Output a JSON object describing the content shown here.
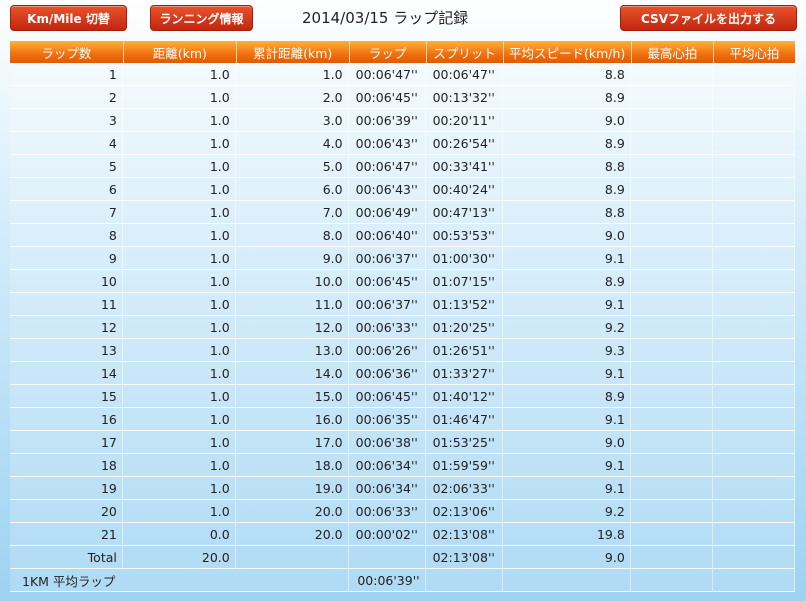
{
  "toolbar": {
    "km_mile_label": "Km/Mile 切替",
    "running_info_label": "ランニング情報",
    "csv_label": "CSVファイルを出力する"
  },
  "page_title": "2014/03/15 ラップ記録",
  "headers": [
    "ラップ数",
    "距離(km)",
    "累計距離(km)",
    "ラップ",
    "スプリット",
    "平均スピード(km/h)",
    "最高心拍",
    "平均心拍"
  ],
  "laps": [
    {
      "lap": "1",
      "dist": "1.0",
      "cum": "1.0",
      "lap_time": "00:06'47''",
      "split": "00:06'47''",
      "speed": "8.8",
      "max_hr": "",
      "avg_hr": ""
    },
    {
      "lap": "2",
      "dist": "1.0",
      "cum": "2.0",
      "lap_time": "00:06'45''",
      "split": "00:13'32''",
      "speed": "8.9",
      "max_hr": "",
      "avg_hr": ""
    },
    {
      "lap": "3",
      "dist": "1.0",
      "cum": "3.0",
      "lap_time": "00:06'39''",
      "split": "00:20'11''",
      "speed": "9.0",
      "max_hr": "",
      "avg_hr": ""
    },
    {
      "lap": "4",
      "dist": "1.0",
      "cum": "4.0",
      "lap_time": "00:06'43''",
      "split": "00:26'54''",
      "speed": "8.9",
      "max_hr": "",
      "avg_hr": ""
    },
    {
      "lap": "5",
      "dist": "1.0",
      "cum": "5.0",
      "lap_time": "00:06'47''",
      "split": "00:33'41''",
      "speed": "8.8",
      "max_hr": "",
      "avg_hr": ""
    },
    {
      "lap": "6",
      "dist": "1.0",
      "cum": "6.0",
      "lap_time": "00:06'43''",
      "split": "00:40'24''",
      "speed": "8.9",
      "max_hr": "",
      "avg_hr": ""
    },
    {
      "lap": "7",
      "dist": "1.0",
      "cum": "7.0",
      "lap_time": "00:06'49''",
      "split": "00:47'13''",
      "speed": "8.8",
      "max_hr": "",
      "avg_hr": ""
    },
    {
      "lap": "8",
      "dist": "1.0",
      "cum": "8.0",
      "lap_time": "00:06'40''",
      "split": "00:53'53''",
      "speed": "9.0",
      "max_hr": "",
      "avg_hr": ""
    },
    {
      "lap": "9",
      "dist": "1.0",
      "cum": "9.0",
      "lap_time": "00:06'37''",
      "split": "01:00'30''",
      "speed": "9.1",
      "max_hr": "",
      "avg_hr": ""
    },
    {
      "lap": "10",
      "dist": "1.0",
      "cum": "10.0",
      "lap_time": "00:06'45''",
      "split": "01:07'15''",
      "speed": "8.9",
      "max_hr": "",
      "avg_hr": ""
    },
    {
      "lap": "11",
      "dist": "1.0",
      "cum": "11.0",
      "lap_time": "00:06'37''",
      "split": "01:13'52''",
      "speed": "9.1",
      "max_hr": "",
      "avg_hr": ""
    },
    {
      "lap": "12",
      "dist": "1.0",
      "cum": "12.0",
      "lap_time": "00:06'33''",
      "split": "01:20'25''",
      "speed": "9.2",
      "max_hr": "",
      "avg_hr": ""
    },
    {
      "lap": "13",
      "dist": "1.0",
      "cum": "13.0",
      "lap_time": "00:06'26''",
      "split": "01:26'51''",
      "speed": "9.3",
      "max_hr": "",
      "avg_hr": ""
    },
    {
      "lap": "14",
      "dist": "1.0",
      "cum": "14.0",
      "lap_time": "00:06'36''",
      "split": "01:33'27''",
      "speed": "9.1",
      "max_hr": "",
      "avg_hr": ""
    },
    {
      "lap": "15",
      "dist": "1.0",
      "cum": "15.0",
      "lap_time": "00:06'45''",
      "split": "01:40'12''",
      "speed": "8.9",
      "max_hr": "",
      "avg_hr": ""
    },
    {
      "lap": "16",
      "dist": "1.0",
      "cum": "16.0",
      "lap_time": "00:06'35''",
      "split": "01:46'47''",
      "speed": "9.1",
      "max_hr": "",
      "avg_hr": ""
    },
    {
      "lap": "17",
      "dist": "1.0",
      "cum": "17.0",
      "lap_time": "00:06'38''",
      "split": "01:53'25''",
      "speed": "9.0",
      "max_hr": "",
      "avg_hr": ""
    },
    {
      "lap": "18",
      "dist": "1.0",
      "cum": "18.0",
      "lap_time": "00:06'34''",
      "split": "01:59'59''",
      "speed": "9.1",
      "max_hr": "",
      "avg_hr": ""
    },
    {
      "lap": "19",
      "dist": "1.0",
      "cum": "19.0",
      "lap_time": "00:06'34''",
      "split": "02:06'33''",
      "speed": "9.1",
      "max_hr": "",
      "avg_hr": ""
    },
    {
      "lap": "20",
      "dist": "1.0",
      "cum": "20.0",
      "lap_time": "00:06'33''",
      "split": "02:13'06''",
      "speed": "9.2",
      "max_hr": "",
      "avg_hr": ""
    },
    {
      "lap": "21",
      "dist": "0.0",
      "cum": "20.0",
      "lap_time": "00:00'02''",
      "split": "02:13'08''",
      "speed": "19.8",
      "max_hr": "",
      "avg_hr": ""
    }
  ],
  "total": {
    "label": "Total",
    "dist": "20.0",
    "split": "02:13'08''",
    "speed": "9.0"
  },
  "avg_lap": {
    "label": "1KM 平均ラップ",
    "lap_time": "00:06'39''"
  },
  "colors": {
    "button": "#d03a18",
    "header": "#f07010",
    "bg": "#9dd2f2"
  }
}
